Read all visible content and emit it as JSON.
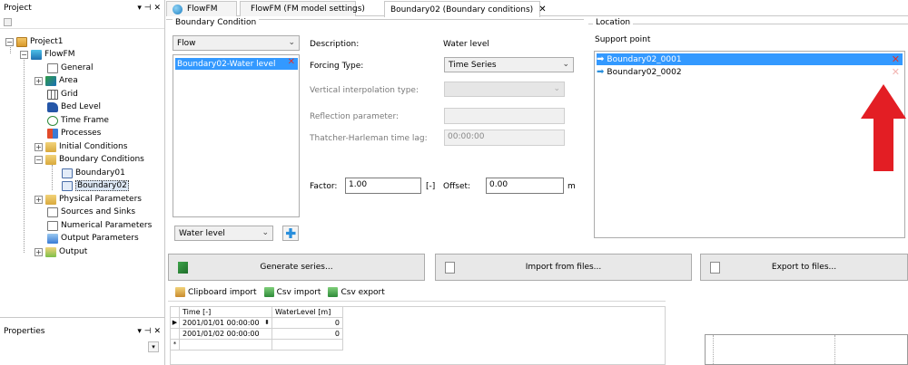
{
  "project_panel": {
    "title": "Project",
    "pin": "▾ ⊣ ✕",
    "tree": [
      {
        "label": "Project1"
      },
      {
        "label": "FlowFM"
      },
      {
        "label": "General"
      },
      {
        "label": "Area"
      },
      {
        "label": "Grid"
      },
      {
        "label": "Bed Level"
      },
      {
        "label": "Time Frame"
      },
      {
        "label": "Processes"
      },
      {
        "label": "Initial Conditions"
      },
      {
        "label": "Boundary Conditions"
      },
      {
        "label": "Boundary01"
      },
      {
        "label": "Boundary02"
      },
      {
        "label": "Physical Parameters"
      },
      {
        "label": "Sources and Sinks"
      },
      {
        "label": "Numerical Parameters"
      },
      {
        "label": "Output Parameters"
      },
      {
        "label": "Output"
      }
    ]
  },
  "properties_panel": {
    "title": "Properties",
    "pin": "▾ ⊣ ✕"
  },
  "tabs": [
    {
      "label": "FlowFM"
    },
    {
      "label": "FlowFM (FM model settings)"
    },
    {
      "label": "Boundary02 (Boundary conditions)"
    }
  ],
  "boundary_condition": {
    "title": "Boundary Condition",
    "quantity_combo": "Flow",
    "list_item": "Boundary02-Water level",
    "description_label": "Description:",
    "description_value": "Water level",
    "forcing_type_label": "Forcing Type:",
    "forcing_type_value": "Time Series",
    "vertical_interp_label": "Vertical interpolation type:",
    "reflection_label": "Reflection parameter:",
    "thatcher_label": "Thatcher-Harleman time lag:",
    "thatcher_value": "00:00:00",
    "factor_label": "Factor:",
    "factor_value": "1.00",
    "factor_unit": "[-]",
    "offset_label": "Offset:",
    "offset_value": "0.00",
    "offset_unit": "m",
    "add_combo": "Water level"
  },
  "location": {
    "title": "Location",
    "support_point_label": "Support point",
    "points": [
      "Boundary02_0001",
      "Boundary02_0002"
    ]
  },
  "actions": {
    "generate": "Generate series...",
    "import": "Import from files...",
    "export": "Export to files..."
  },
  "grid_toolbar": {
    "clipboard": "Clipboard import",
    "csv_import": "Csv import",
    "csv_export": "Csv export"
  },
  "table": {
    "headers": [
      "Time [-]",
      "WaterLevel [m]"
    ],
    "rows": [
      {
        "time": "2001/01/01 00:00:00",
        "value": "0"
      },
      {
        "time": "2001/01/02 00:00:00",
        "value": "0"
      }
    ],
    "new_row_marker": "*"
  },
  "colors": {
    "selection": "#3399ff",
    "remove": "#e0302a",
    "annotation_arrow": "#e31e24"
  }
}
